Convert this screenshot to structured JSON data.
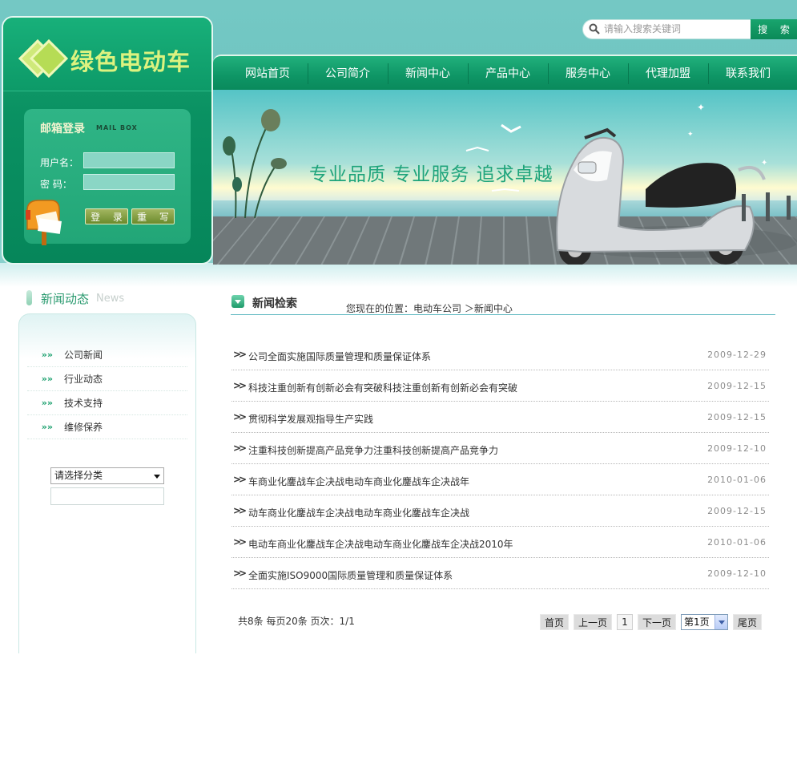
{
  "header": {
    "logo_text": "绿色电动车",
    "search": {
      "placeholder": "请输入搜索关键词",
      "button_label": "搜 索"
    },
    "nav": [
      "网站首页",
      "公司简介",
      "新闻中心",
      "产品中心",
      "服务中心",
      "代理加盟",
      "联系我们"
    ],
    "banner_slogan": "专业品质  专业服务  追求卓越"
  },
  "login": {
    "title": "邮箱登录",
    "subtitle": "MAIL BOX",
    "username_label": "用户名：",
    "password_label": "密  码：",
    "login_button": "登 录",
    "reset_button": "重 写"
  },
  "sidebar": {
    "title": "新闻动态",
    "title_en": "News",
    "items": [
      {
        "arrow": "»»",
        "label": "公司新闻"
      },
      {
        "arrow": "»»",
        "label": "行业动态"
      },
      {
        "arrow": "»»",
        "label": "技术支持"
      },
      {
        "arrow": "»»",
        "label": "维修保养"
      }
    ],
    "category_select": "请选择分类"
  },
  "main": {
    "title": "新闻检索",
    "breadcrumb": "您现在的位置：电动车公司 ＞新闻中心",
    "news": [
      {
        "title": "公司全面实施国际质量管理和质量保证体系",
        "date": "2009-12-29"
      },
      {
        "title": "科技注重创新有创新必会有突破科技注重创新有创新必会有突破",
        "date": "2009-12-15"
      },
      {
        "title": "贯彻科学发展观指导生产实践",
        "date": "2009-12-15"
      },
      {
        "title": "注重科技创新提高产品竞争力注重科技创新提高产品竞争力",
        "date": "2009-12-10"
      },
      {
        "title": "车商业化鏖战车企决战电动车商业化鏖战车企决战年",
        "date": "2010-01-06"
      },
      {
        "title": "动车商业化鏖战车企决战电动车商业化鏖战车企决战",
        "date": "2009-12-15"
      },
      {
        "title": "电动车商业化鏖战车企决战电动车商业化鏖战车企决战2010年",
        "date": "2010-01-06"
      },
      {
        "title": "全面实施ISO9000国际质量管理和质量保证体系",
        "date": "2009-12-10"
      }
    ],
    "pagination": {
      "info": "共8条  每页20条  页次：1/1",
      "first": "首页",
      "prev": "上一页",
      "current": "1",
      "next": "下一页",
      "select": "第1页",
      "last": "尾页"
    }
  }
}
